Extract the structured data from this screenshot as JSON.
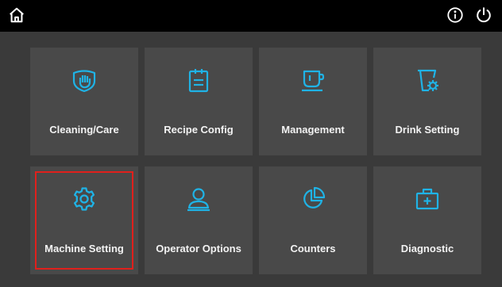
{
  "colors": {
    "accent": "#1fb3e6",
    "selection": "#e0201c",
    "tile": "#494949",
    "background": "#3a3a3a"
  },
  "topbar": {
    "icons": [
      "home-icon",
      "info-icon",
      "power-icon"
    ]
  },
  "tiles": [
    {
      "label": "Cleaning/Care",
      "icon": "cleaning-hand-icon"
    },
    {
      "label": "Recipe Config",
      "icon": "clipboard-icon"
    },
    {
      "label": "Management",
      "icon": "cup-icon"
    },
    {
      "label": "Drink Setting",
      "icon": "drink-gear-icon"
    },
    {
      "label": "Machine Setting",
      "icon": "gear-icon",
      "selected": true
    },
    {
      "label": "Operator Options",
      "icon": "user-icon"
    },
    {
      "label": "Counters",
      "icon": "pie-chart-icon"
    },
    {
      "label": "Diagnostic",
      "icon": "first-aid-icon"
    }
  ]
}
